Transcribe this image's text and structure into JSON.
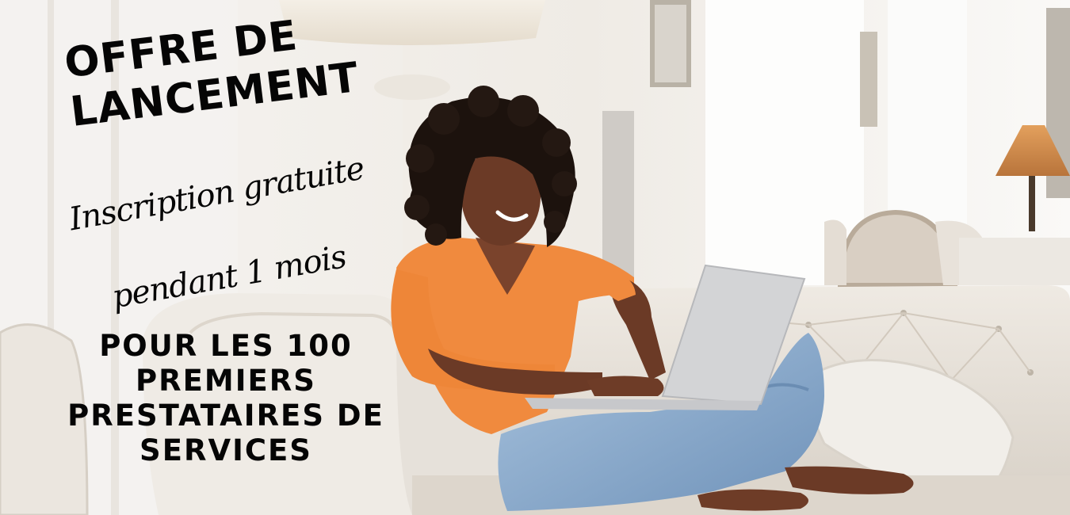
{
  "banner": {
    "headline_line1": "OFFRE DE",
    "headline_line2": "LANCEMENT",
    "script_line1": "Inscription gratuite",
    "script_line2": "pendant 1 mois",
    "footer_line1": "POUR LES 100",
    "footer_line2": "PREMIERS",
    "footer_line3": "PRESTATAIRES DE",
    "footer_line4": "SERVICES"
  },
  "colors": {
    "text": "#050505",
    "sweater": "#f08a3e",
    "jeans": "#8fb1d3",
    "sofa": "#e9e4dc",
    "skin": "#6b3a26",
    "hair": "#1c120d",
    "laptop": "#d3d4d6"
  },
  "icons": {
    "photo": "woman-with-laptop-photo"
  }
}
